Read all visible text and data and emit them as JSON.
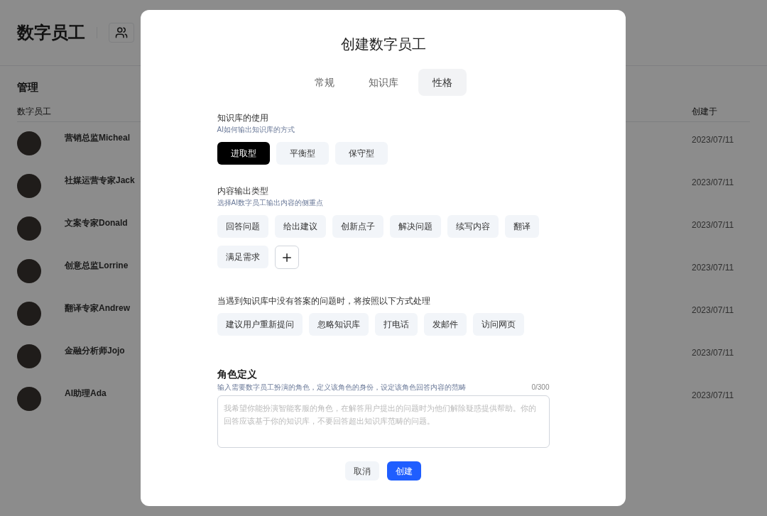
{
  "page": {
    "title": "数字员工",
    "section_title": "管理",
    "columns": [
      "数字员工",
      "创建于"
    ],
    "rows": [
      {
        "name": "营销总监Micheal",
        "created": "2023/07/11"
      },
      {
        "name": "社媒运营专家Jack",
        "created": "2023/07/11"
      },
      {
        "name": "文案专家Donald",
        "created": "2023/07/11"
      },
      {
        "name": "创意总监Lorrine",
        "created": "2023/07/11"
      },
      {
        "name": "翻译专家Andrew",
        "created": "2023/07/11"
      },
      {
        "name": "金融分析师Jojo",
        "created": "2023/07/11"
      },
      {
        "name": "AI助理Ada",
        "created": "2023/07/11"
      }
    ]
  },
  "dialog": {
    "title": "创建数字员工",
    "tabs": [
      {
        "label": "常规",
        "selected": false
      },
      {
        "label": "知识库",
        "selected": false
      },
      {
        "label": "性格",
        "selected": true
      }
    ],
    "sections": [
      {
        "title": "知识库的使用",
        "subtitle": "AI如何输出知识库的方式",
        "options": [
          {
            "label": "进取型",
            "selected": true
          },
          {
            "label": "平衡型",
            "selected": false
          },
          {
            "label": "保守型",
            "selected": false
          }
        ],
        "add_button": false
      },
      {
        "title": "内容输出类型",
        "subtitle": "选择AI数字员工输出内容的侧重点",
        "options": [
          {
            "label": "回答问题",
            "selected": false
          },
          {
            "label": "给出建议",
            "selected": false
          },
          {
            "label": "创新点子",
            "selected": false
          },
          {
            "label": "解决问题",
            "selected": false
          },
          {
            "label": "续写内容",
            "selected": false
          },
          {
            "label": "翻译",
            "selected": false
          },
          {
            "label": "满足需求",
            "selected": false
          }
        ],
        "add_button": true
      },
      {
        "title": "当遇到知识库中没有答案的问题时，将按照以下方式处理",
        "options": [
          {
            "label": "建议用户重新提问",
            "selected": false
          },
          {
            "label": "忽略知识库",
            "selected": false
          },
          {
            "label": "打电话",
            "selected": false
          },
          {
            "label": "发邮件",
            "selected": false
          },
          {
            "label": "访问网页",
            "selected": false
          }
        ],
        "add_button": false
      }
    ],
    "role": {
      "title": "角色定义",
      "hint": "输入需要数字员工扮演的角色，定义该角色的身份，设定该角色回答内容的范畴",
      "counter": "0/300",
      "placeholder": "我希望你能扮演智能客服的角色，在解答用户提出的问题时为他们解除疑惑提供帮助。你的回答应该基于你的知识库，不要回答超出知识库范畴的问题。"
    },
    "buttons": [
      {
        "label": "取消",
        "kind": "secondary"
      },
      {
        "label": "创建",
        "kind": "primary"
      }
    ]
  }
}
